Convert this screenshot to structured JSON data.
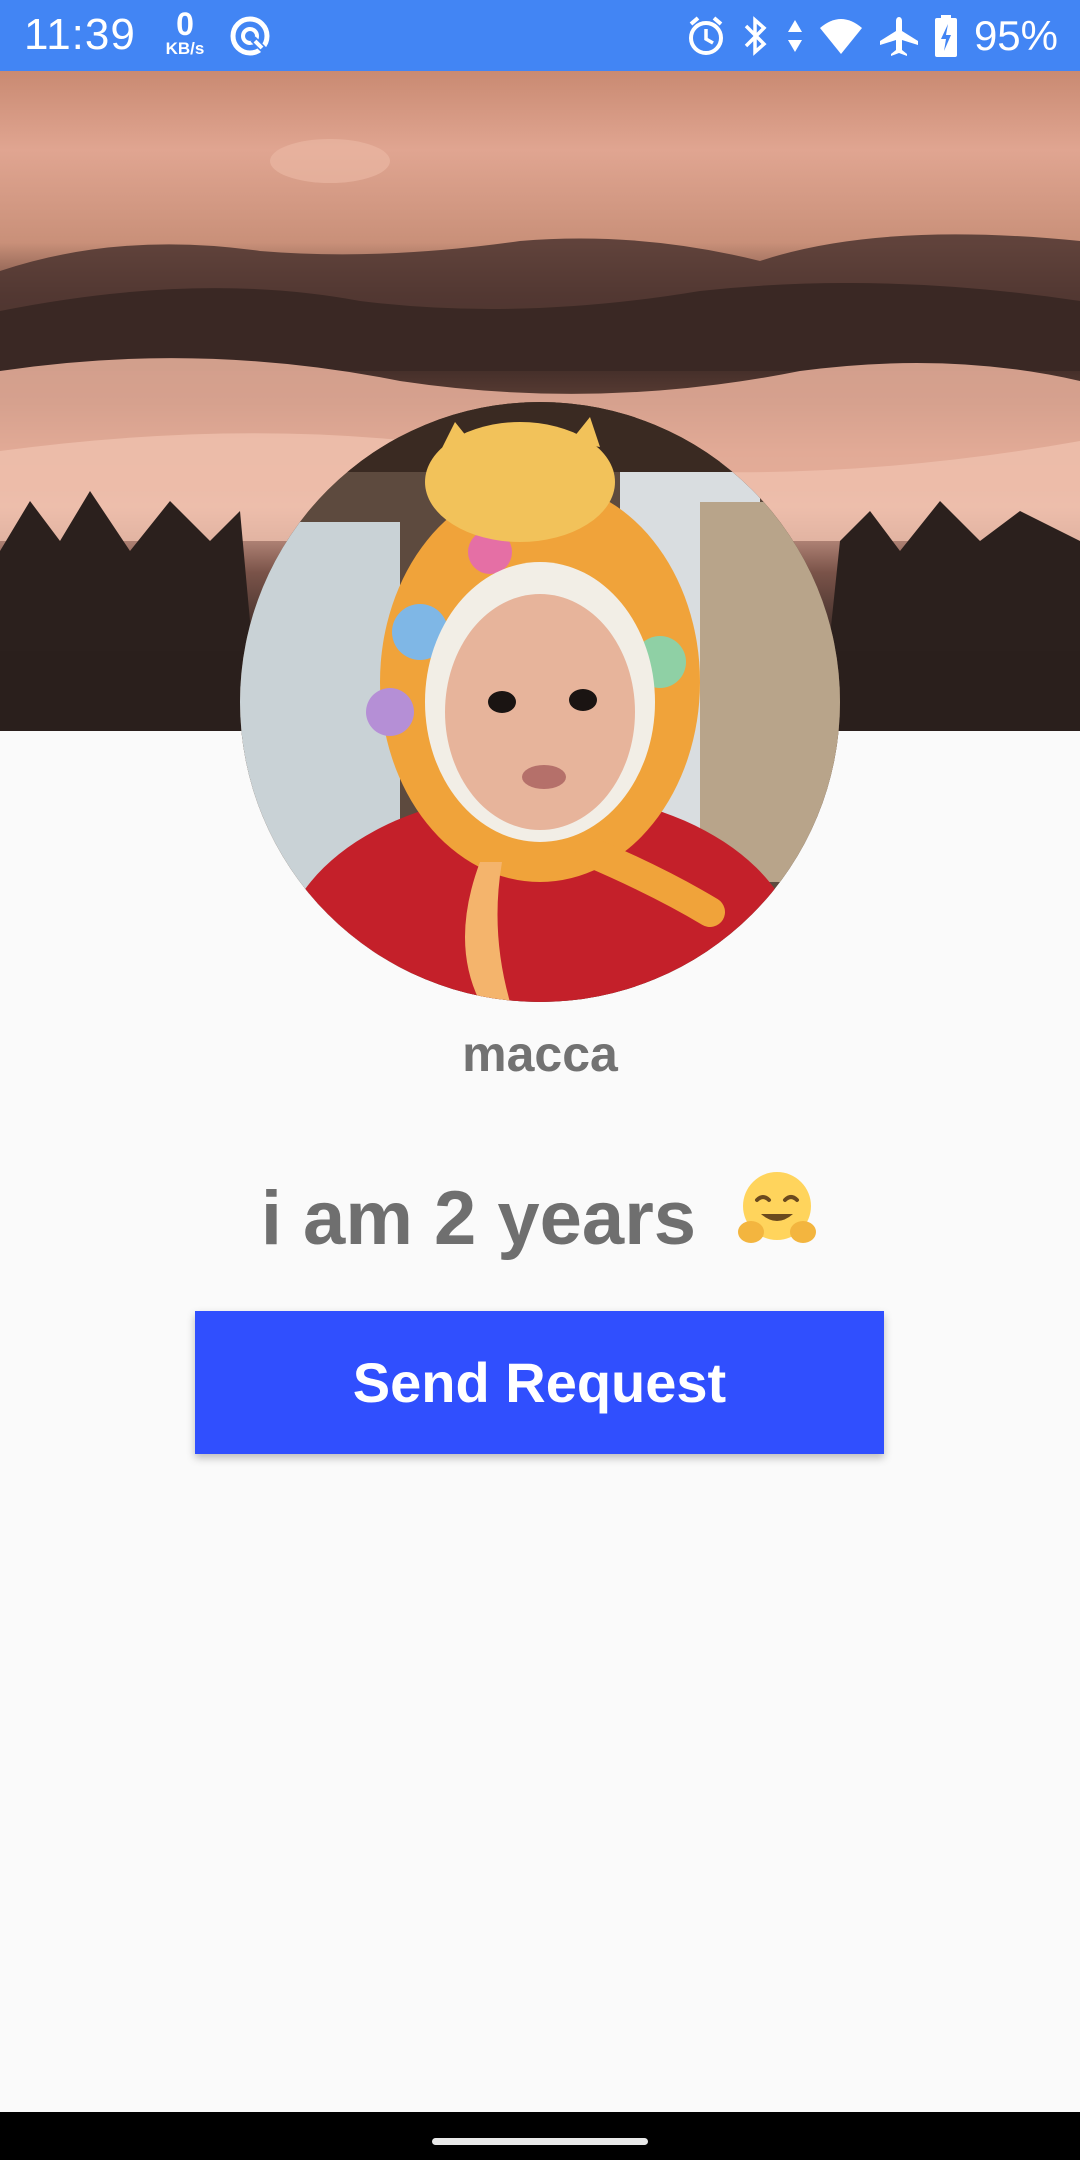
{
  "status_bar": {
    "time": "11:39",
    "net_speed_value": "0",
    "net_speed_unit": "KB/s",
    "battery_percent": "95%",
    "icons": [
      "sync-icon",
      "alarm-icon",
      "bluetooth-icon",
      "data-arrows-icon",
      "wifi-icon",
      "airplane-icon",
      "battery-charging-icon"
    ],
    "color": "#4285f4"
  },
  "profile": {
    "username": "macca",
    "bio_text": "i am 2 years",
    "bio_emoji": "hugging-face-emoji"
  },
  "actions": {
    "send_request_label": "Send Request",
    "button_color": "#304ffe"
  }
}
